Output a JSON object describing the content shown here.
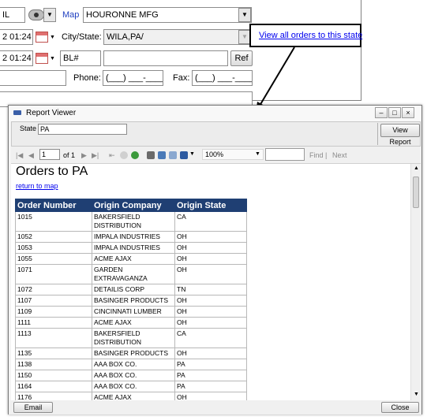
{
  "form": {
    "top_partial": "IL",
    "map_link": "Map",
    "company": "HOURONNE MFG",
    "date1": "2 01:24",
    "date2": "2 01:24",
    "city_state_label": "City/State:",
    "city_state_value": "WILA,PA/",
    "bl_value": "BL#",
    "ref_button": "Ref",
    "phone_label": "Phone:",
    "phone_value": "(___) ___-____",
    "fax_label": "Fax:",
    "fax_value": "(___) ___-____",
    "view_all_link": "View all orders to this state"
  },
  "viewer": {
    "title": "Report Viewer",
    "state_label": "State",
    "state_value": "PA",
    "view_report_button": "View Report",
    "toolbar": {
      "page_value": "1",
      "page_of": "of 1",
      "zoom": "100%",
      "find": "Find",
      "separator": "|",
      "next": "Next"
    },
    "report": {
      "title": "Orders to PA",
      "return_link": "return to map",
      "columns": [
        "Order Number",
        "Origin Company",
        "Origin State"
      ],
      "rows": [
        [
          "1015",
          "BAKERSFIELD DISTRIBUTION",
          "CA"
        ],
        [
          "1052",
          "IMPALA INDUSTRIES",
          "OH"
        ],
        [
          "1053",
          "IMPALA INDUSTRIES",
          "OH"
        ],
        [
          "1055",
          "ACME AJAX",
          "OH"
        ],
        [
          "1071",
          "GARDEN EXTRAVAGANZA",
          "OH"
        ],
        [
          "1072",
          "DETAILIS CORP",
          "TN"
        ],
        [
          "1107",
          "BASINGER PRODUCTS",
          "OH"
        ],
        [
          "1109",
          "CINCINNATI LUMBER",
          "OH"
        ],
        [
          "1111",
          "ACME AJAX",
          "OH"
        ],
        [
          "1113",
          "BAKERSFIELD DISTRIBUTION",
          "CA"
        ],
        [
          "1135",
          "BASINGER PRODUCTS",
          "OH"
        ],
        [
          "1138",
          "AAA BOX CO.",
          "PA"
        ],
        [
          "1150",
          "AAA BOX CO.",
          "PA"
        ],
        [
          "1164",
          "AAA BOX CO.",
          "PA"
        ],
        [
          "1176",
          "ACME AJAX",
          "OH"
        ]
      ]
    },
    "email_button": "Email",
    "close_button": "Close"
  }
}
